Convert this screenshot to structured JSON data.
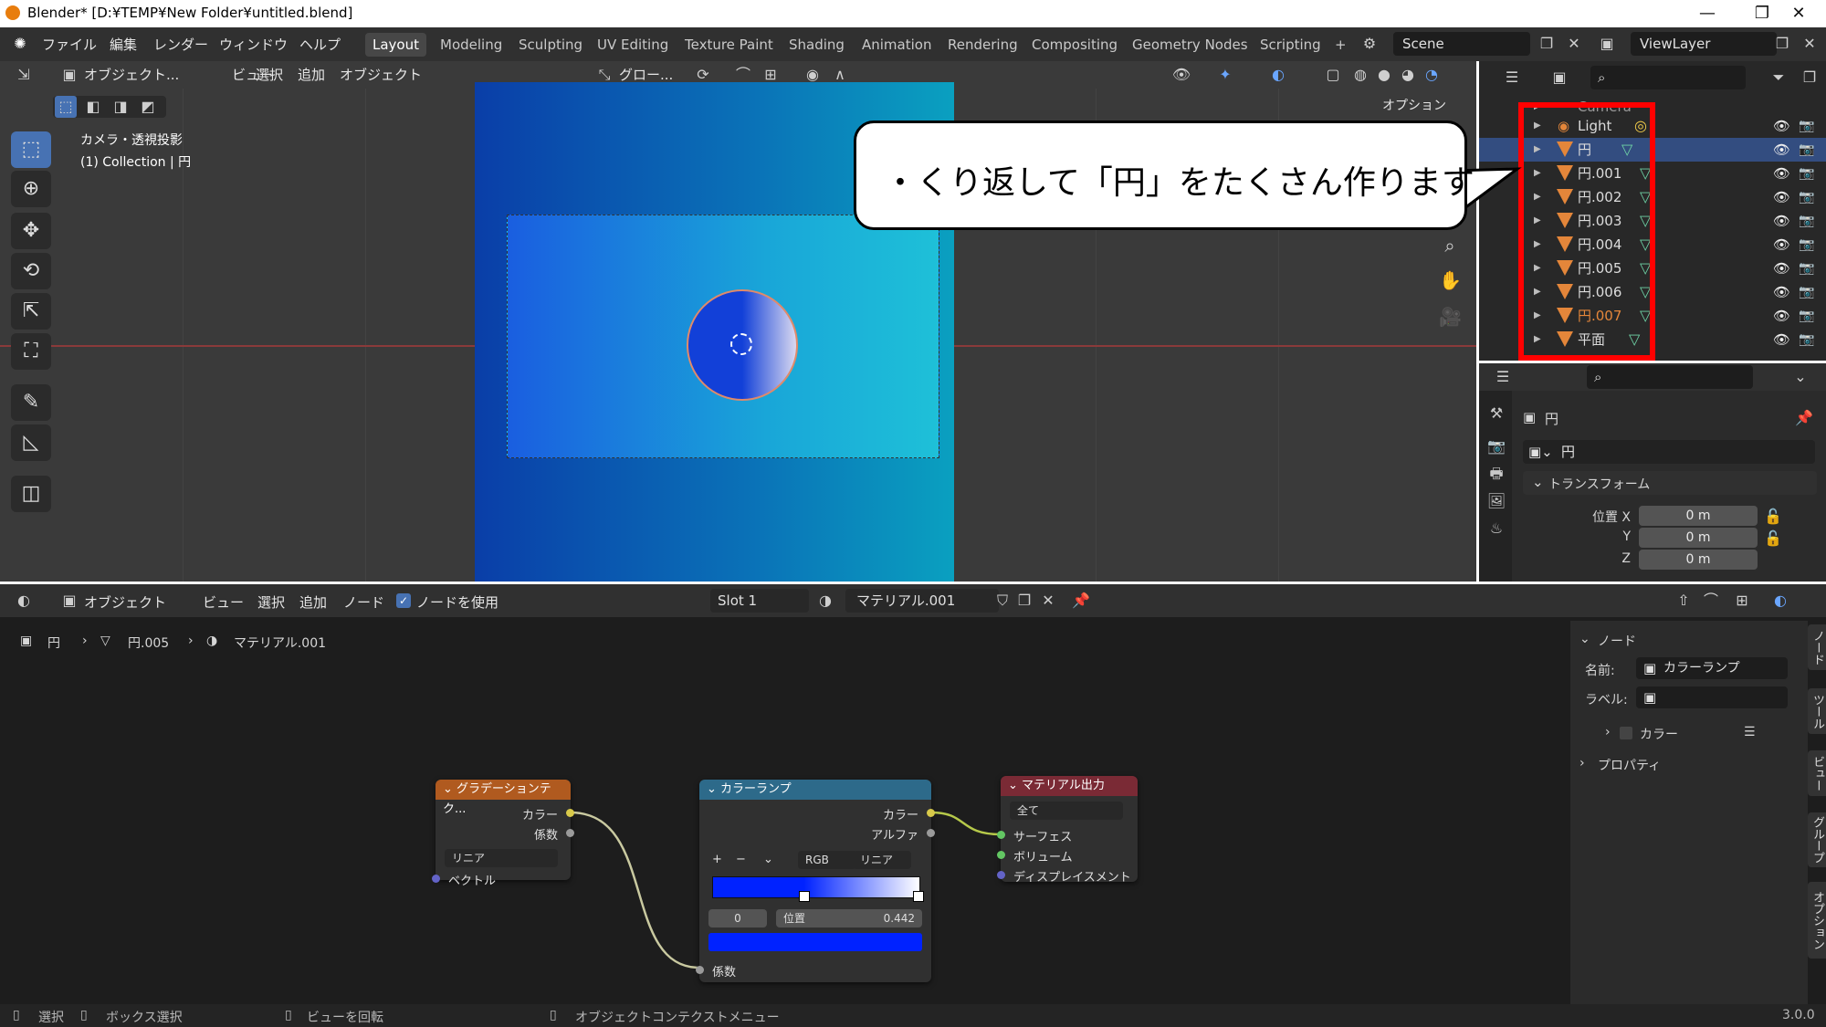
{
  "window": {
    "title": "Blender* [D:¥TEMP¥New Folder¥untitled.blend]",
    "minimize": "—",
    "maximize": "❐",
    "close": "✕"
  },
  "menubar": {
    "menus": [
      "ファイル",
      "編集",
      "レンダー",
      "ウィンドウ",
      "ヘルプ"
    ],
    "workspaces": [
      "Layout",
      "Modeling",
      "Sculpting",
      "UV Editing",
      "Texture Paint",
      "Shading",
      "Animation",
      "Rendering",
      "Compositing",
      "Geometry Nodes",
      "Scripting"
    ],
    "active_workspace": "Layout",
    "add_workspace": "+",
    "scene": "Scene",
    "view_layer": "ViewLayer"
  },
  "viewport": {
    "mode": "オブジェクト...",
    "menus": [
      "ビュー",
      "選択",
      "追加",
      "オブジェクト"
    ],
    "transform": "グロー...",
    "options": "オプション",
    "overlay_title": "カメラ・透視投影",
    "overlay_sub": "(1) Collection | 円"
  },
  "callout": {
    "text": "・くり返して「円」をたくさん作ります"
  },
  "outliner": {
    "rows": [
      {
        "name": "Light",
        "type": "light"
      },
      {
        "name": "円",
        "type": "mesh",
        "selected": true
      },
      {
        "name": "円.001",
        "type": "mesh"
      },
      {
        "name": "円.002",
        "type": "mesh"
      },
      {
        "name": "円.003",
        "type": "mesh"
      },
      {
        "name": "円.004",
        "type": "mesh"
      },
      {
        "name": "円.005",
        "type": "mesh"
      },
      {
        "name": "円.006",
        "type": "mesh"
      },
      {
        "name": "円.007",
        "type": "mesh",
        "highlight": true
      },
      {
        "name": "平面",
        "type": "mesh"
      }
    ],
    "colors": {
      "highlight": "#e4863a",
      "selected_bg": "#334d80"
    }
  },
  "properties": {
    "object_name": "円",
    "data_name": "円",
    "section": "トランスフォーム",
    "location_label": "位置 X",
    "y_label": "Y",
    "z_label": "Z",
    "x_value": "0 m",
    "y_value": "0 m",
    "z_value": "0 m"
  },
  "node_editor": {
    "mode": "オブジェクト",
    "menus": [
      "ビュー",
      "選択",
      "追加",
      "ノード"
    ],
    "use_nodes_label": "ノードを使用",
    "slot": "Slot 1",
    "material": "マテリアル.001",
    "breadcrumb": [
      "円",
      "円.005",
      "マテリアル.001"
    ],
    "nodes": {
      "gradient": {
        "title": "グラデーションテク...",
        "out_color": "カラー",
        "out_fac": "係数",
        "type": "リニア",
        "in_vector": "ベクトル"
      },
      "colorramp": {
        "title": "カラーランプ",
        "out_color": "カラー",
        "out_alpha": "アルファ",
        "add": "+",
        "remove": "−",
        "color_mode": "RGB",
        "interp": "リニア",
        "stop_index": "0",
        "pos_label": "位置",
        "pos_value": "0.442",
        "in_fac": "係数"
      },
      "output": {
        "title": "マテリアル出力",
        "target": "全て",
        "surface": "サーフェス",
        "volume": "ボリューム",
        "displacement": "ディスプレイスメント"
      }
    },
    "sidebar": {
      "panel": "ノード",
      "name_label": "名前:",
      "name_value": "カラーランプ",
      "label_label": "ラベル:",
      "color_section": "カラー",
      "props_section": "プロパティ",
      "tabs": [
        "ノード",
        "ツール",
        "ビュー",
        "グループ",
        "オプション"
      ]
    }
  },
  "statusbar": {
    "select": "選択",
    "box_select": "ボックス選択",
    "rotate": "ビューを回転",
    "context": "オブジェクトコンテクストメニュー",
    "version": "3.0.0"
  }
}
